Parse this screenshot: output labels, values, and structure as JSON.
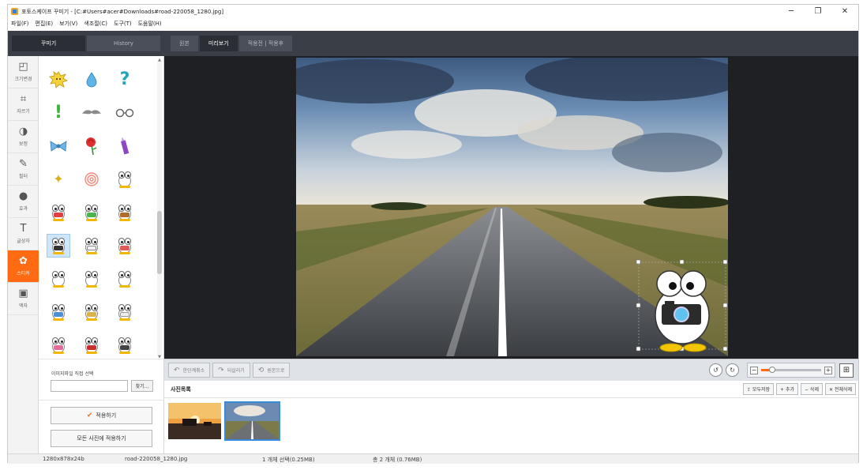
{
  "window": {
    "title": "포토스케이프 꾸미기 - [C:#Users#acer#Downloads#road-220058_1280.jpg]",
    "controls": [
      "─",
      "❐",
      "✕"
    ]
  },
  "menu": [
    "파일(F)",
    "편집(E)",
    "보기(V)",
    "색조절(C)",
    "도구(T)",
    "도움말(H)"
  ],
  "left_tabs": {
    "decorate": "꾸미기",
    "history": "History"
  },
  "view_tabs": {
    "original": "원본",
    "preview": "미리보기",
    "compare": "적용전 | 적용후"
  },
  "tools": [
    {
      "icon": "◰",
      "label": "크기변경"
    },
    {
      "icon": "⌗",
      "label": "자르기"
    },
    {
      "icon": "◑",
      "label": "보정"
    },
    {
      "icon": "✎",
      "label": "필터"
    },
    {
      "icon": "●",
      "label": "효과"
    },
    {
      "icon": "T",
      "label": "글상자"
    },
    {
      "icon": "✿",
      "label": "스티커"
    },
    {
      "icon": "▣",
      "label": "액자"
    }
  ],
  "active_tool": "스티커",
  "stickers": {
    "row1": [
      "burst",
      "drop",
      "question"
    ],
    "row2": [
      "exclaim",
      "mustache",
      "glasses"
    ],
    "row3": [
      "bow",
      "rose",
      "crayon"
    ],
    "row4": [
      "sparkle",
      "spiral",
      "penguin"
    ]
  },
  "file_chooser": {
    "label": "이미지파일 직접 선택",
    "button": "찾기..."
  },
  "apply": {
    "apply_label": "적용하기",
    "apply_all_label": "모든 사진에 적용하기",
    "check_icon": "✔"
  },
  "toolbar": {
    "undo": "한단계취소",
    "redo": "되살리기",
    "revert": "원본으로",
    "zoom_fraction": 0.18
  },
  "photo_list": {
    "title": "사진목록",
    "actions": [
      "⇪ 모두저장",
      "+ 추가",
      "− 삭제",
      "✕ 전체삭제"
    ]
  },
  "status": {
    "dimensions": "1280x878x24b",
    "filename": "road-220058_1280.jpg",
    "selection": "1 개체 선택(0.25MB)",
    "total": "총 2 개체 (0.76MB)"
  },
  "colors": {
    "accent": "#ff6a13",
    "dark_header": "#3a3e47",
    "canvas_bg": "#1f2024",
    "selection_blue": "#3a8bdc"
  }
}
